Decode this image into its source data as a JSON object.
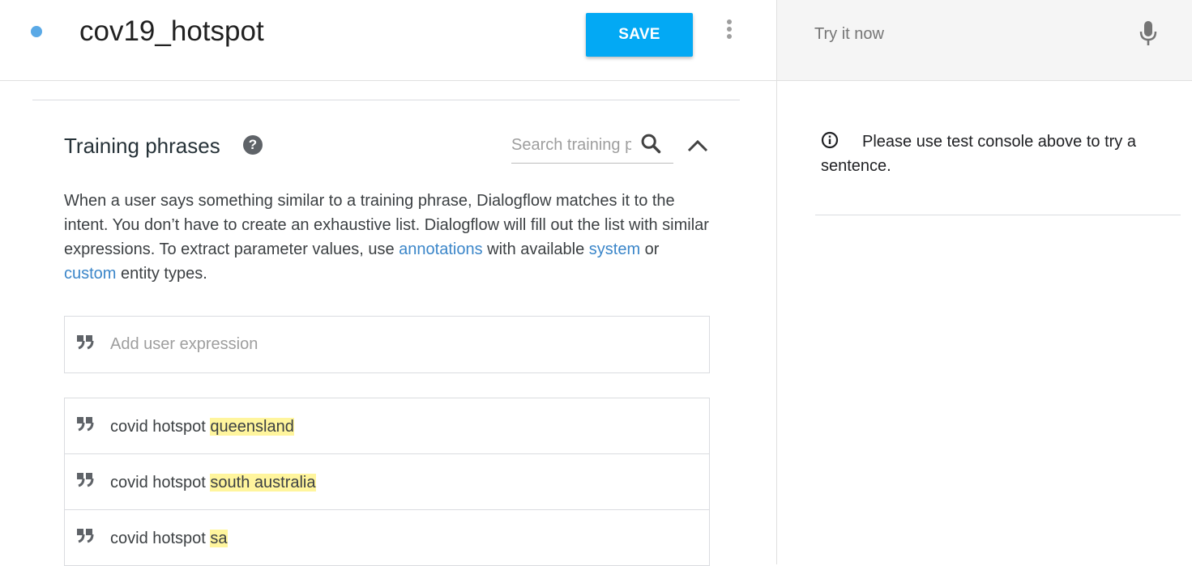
{
  "header": {
    "intent_name": "cov19_hotspot",
    "save_label": "SAVE",
    "status_color": "#5aa9e6",
    "accent_color": "#03a9f4"
  },
  "training": {
    "title": "Training phrases",
    "search_placeholder": "Search training phrases",
    "description": {
      "part1": "When a user says something similar to a training phrase, Dialogflow matches it to the intent. You don’t have to create an exhaustive list. Dialogflow will fill out the list with similar expressions. To extract parameter values, use ",
      "link_annotations": "annotations",
      "part2": " with available ",
      "link_system": "system",
      "part3": " or ",
      "link_custom": "custom",
      "part4": " entity types."
    },
    "add_placeholder": "Add user expression",
    "phrases": [
      {
        "text": "covid hotspot ",
        "entity": "queensland"
      },
      {
        "text": "covid hotspot ",
        "entity": "south australia"
      },
      {
        "text": "covid hotspot ",
        "entity": "sa"
      }
    ],
    "annotation_color": "#fff59d"
  },
  "console": {
    "try_placeholder": "Try it now",
    "info_message": "Please use test console above to try a sentence."
  }
}
